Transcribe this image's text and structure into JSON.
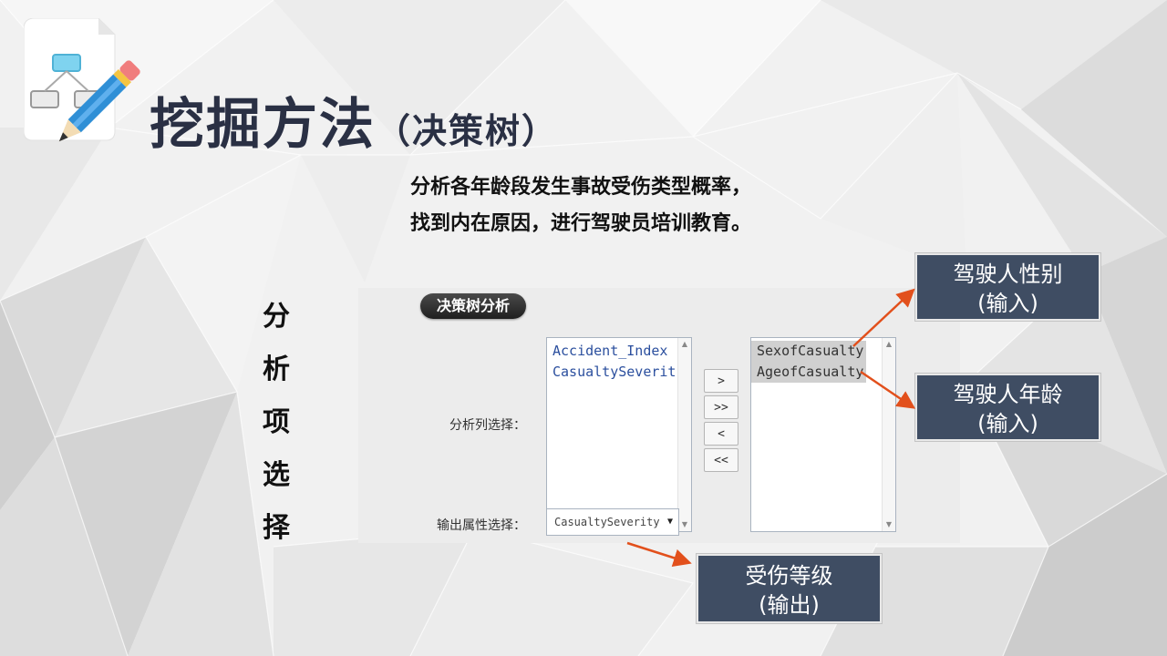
{
  "header": {
    "title": "挖掘方法",
    "subtitle": "（决策树）"
  },
  "description": {
    "line1": "分析各年龄段发生事故受伤类型概率，",
    "line2": "找到内在原因，进行驾驶员培训教育。"
  },
  "side_label": [
    "分",
    "析",
    "项",
    "选",
    "择"
  ],
  "panel": {
    "section_title": "决策树分析",
    "column_select_label": "分析列选择：",
    "available_columns": [
      "Accident_Index",
      "CasualtySeverit"
    ],
    "selected_columns": [
      "SexofCasualty",
      "AgeofCasualty"
    ],
    "buttons": {
      "add": ">",
      "add_all": ">>",
      "remove": "<",
      "remove_all": "<<"
    },
    "output_label": "输出属性选择：",
    "output_value": "CasualtySeverity"
  },
  "callouts": {
    "gender": {
      "line1": "驾驶人性别",
      "line2": "(输入)"
    },
    "age": {
      "line1": "驾驶人年龄",
      "line2": "(输入)"
    },
    "severity": {
      "line1": "受伤等级",
      "line2": "(输出)"
    }
  },
  "icons": {
    "logo": "flowchart-pencil-icon",
    "scroll_up": "scroll-up-icon",
    "scroll_down": "scroll-down-icon",
    "dropdown": "chevron-down-icon"
  },
  "colors": {
    "title": "#2a3044",
    "callout_bg": "#3f4d63",
    "arrow": "#e2501c",
    "list_text": "#2b4f9e",
    "panel_bg": "#ececec"
  }
}
